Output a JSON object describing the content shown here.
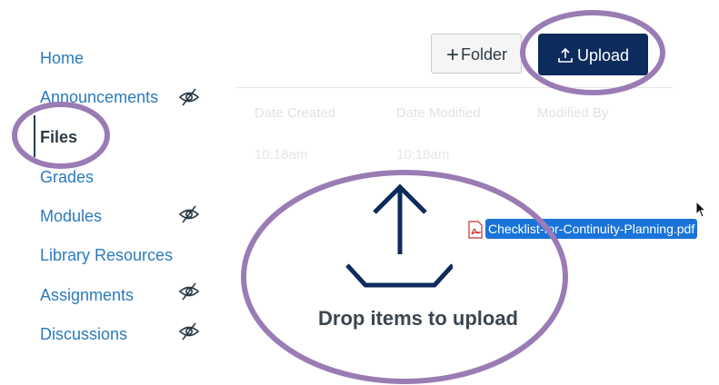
{
  "sidebar": {
    "items": [
      {
        "label": "Home",
        "hidden_icon": false
      },
      {
        "label": "Announcements",
        "hidden_icon": true
      },
      {
        "label": "Files",
        "hidden_icon": false,
        "active": true
      },
      {
        "label": "Grades",
        "hidden_icon": false
      },
      {
        "label": "Modules",
        "hidden_icon": true
      },
      {
        "label": "Library Resources",
        "hidden_icon": false
      },
      {
        "label": "Assignments",
        "hidden_icon": true
      },
      {
        "label": "Discussions",
        "hidden_icon": true
      }
    ]
  },
  "toolbar": {
    "folder_label": "Folder",
    "upload_label": "Upload"
  },
  "table": {
    "columns": [
      "Date Created",
      "Date Modified",
      "Modified By"
    ],
    "rows": [
      [
        "10:18am",
        "10:18am",
        ""
      ]
    ]
  },
  "drop_zone": {
    "text": "Drop items to upload",
    "icon": "upload-arrow-icon"
  },
  "dragged_file": {
    "name": "Checklist-for-Continuity-Planning.pdf",
    "icon": "pdf-icon"
  },
  "colors": {
    "link": "#2b7abc",
    "active_text": "#2d3b45",
    "upload_button": "#0d2b5c",
    "highlight_ring": "#9a7cb5",
    "drag_chip": "#1a73d9"
  }
}
